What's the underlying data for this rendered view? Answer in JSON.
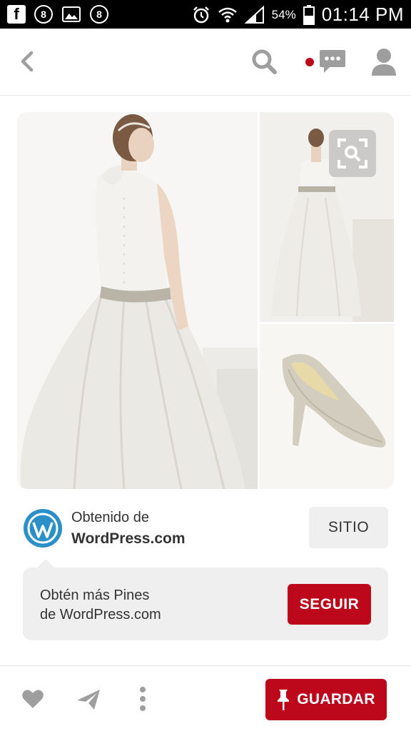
{
  "status_bar": {
    "left_icons": [
      "facebook-icon",
      "counter-icon",
      "image-icon",
      "counter-icon"
    ],
    "counter_a": "8",
    "counter_b": "8",
    "battery_percent": "54%",
    "time": "01:14 PM"
  },
  "toolbar": {
    "back_icon": "chevron-left-icon",
    "search_icon": "search-icon",
    "messages_icon": "chat-bubble-icon",
    "profile_icon": "user-icon",
    "notification_dot_color": "#bd081c"
  },
  "pin": {
    "images": [
      "wedding-dress-back-view",
      "wedding-dress-full-view",
      "sparkly-silver-pump"
    ],
    "visual_search_icon": "visual-search-icon"
  },
  "source": {
    "label": "Obtenido de",
    "name": "WordPress.com",
    "logo_icon": "wordpress-icon",
    "button_label": "SITIO"
  },
  "follow": {
    "text_line1": "Obtén más Pines",
    "text_line2": "de WordPress.com",
    "button_label": "SEGUIR"
  },
  "bottom_bar": {
    "like_icon": "heart-icon",
    "send_icon": "send-icon",
    "more_icon": "more-vertical-icon",
    "save_label": "GUARDAR",
    "save_icon": "pushpin-icon"
  },
  "colors": {
    "brand_red": "#bd081c",
    "icon_gray": "#9e9e9e",
    "button_gray": "#efefef"
  }
}
